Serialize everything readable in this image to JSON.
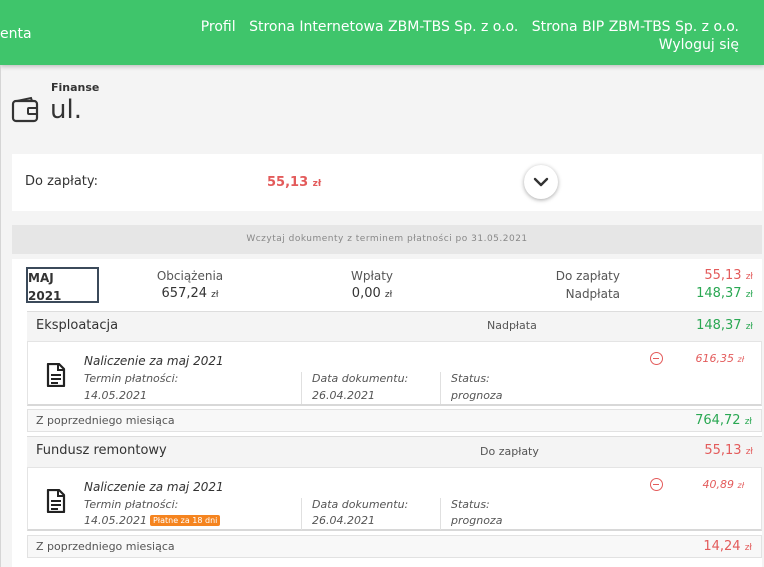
{
  "topbar": {
    "left_fragment": "enta",
    "links": [
      "Profil",
      "Strona Internetowa ZBM-TBS Sp. z o.o.",
      "Strona BIP ZBM-TBS Sp. z o.o."
    ],
    "logout": "Wyloguj się"
  },
  "header": {
    "subtitle": "Finanse",
    "title": "ul."
  },
  "summary": {
    "label": "Do zapłaty:",
    "amount": "55,13",
    "currency": "zł"
  },
  "load_more": "Wczytaj dokumenty z terminem płatności po 31.05.2021",
  "month": {
    "name": "MAJ",
    "year": "2021",
    "charges_label": "Obciążenia",
    "charges_value": "657,24",
    "payments_label": "Wpłaty",
    "payments_value": "0,00",
    "due_label": "Do zapłaty",
    "overpay_label": "Nadpłata",
    "due_value": "55,13",
    "overpay_value": "148,37",
    "currency": "zł"
  },
  "sections": [
    {
      "name": "Eksploatacja",
      "status_label": "Nadpłata",
      "value": "148,37",
      "doc": {
        "title": "Naliczenie za maj 2021",
        "due_label": "Termin płatności:",
        "due_value": "14.05.2021",
        "date_label": "Data dokumentu:",
        "date_value": "26.04.2021",
        "status_label": "Status:",
        "status_value": "prognoza",
        "amount": "616,35",
        "badge": ""
      },
      "prev_label": "Z poprzedniego miesiąca",
      "prev_value": "764,72"
    },
    {
      "name": "Fundusz remontowy",
      "status_label": "Do zapłaty",
      "value": "55,13",
      "doc": {
        "title": "Naliczenie za maj 2021",
        "due_label": "Termin płatności:",
        "due_value": "14.05.2021",
        "date_label": "Data dokumentu:",
        "date_value": "26.04.2021",
        "status_label": "Status:",
        "status_value": "prognoza",
        "amount": "40,89",
        "badge": "Płatne za 18 dni"
      },
      "prev_label": "Z poprzedniego miesiąca",
      "prev_value": "14,24"
    }
  ],
  "colors": {
    "brand": "#3fc56b",
    "due": "#e35b5b",
    "overpay": "#2aa853",
    "badge": "#f5841f"
  },
  "icons": [
    "wallet-icon",
    "chevron-down-icon",
    "document-icon",
    "minus-circle-icon"
  ]
}
